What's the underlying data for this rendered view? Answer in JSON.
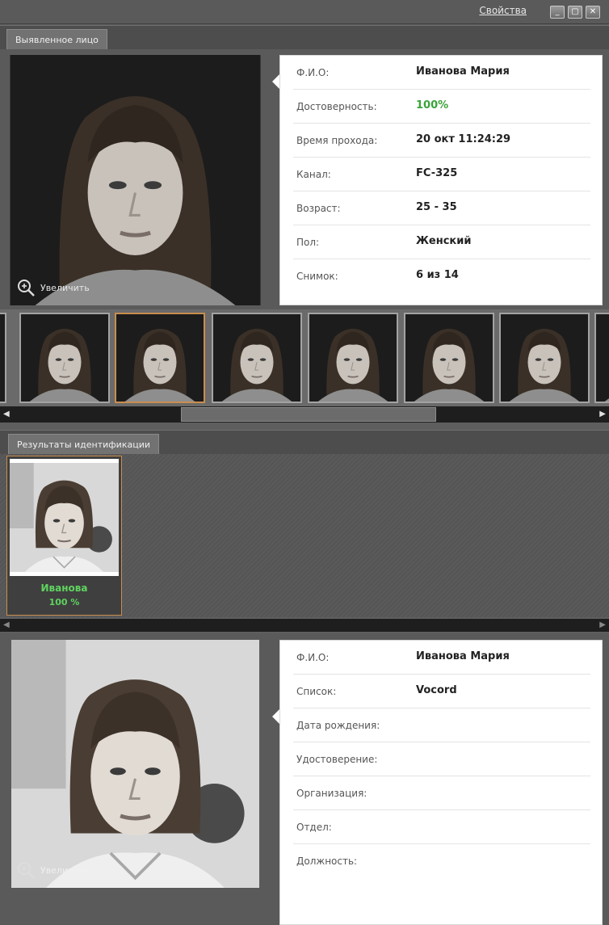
{
  "titlebar": {
    "properties_link": "Свойства",
    "min_glyph": "_",
    "max_glyph": "▢",
    "close_glyph": "✕"
  },
  "detected": {
    "tab_label": "Выявленное лицо",
    "zoom_label": "Увеличить",
    "fields": [
      {
        "label": "Ф.И.О:",
        "value": "Иванова Мария"
      },
      {
        "label": "Достоверность:",
        "value": "100%"
      },
      {
        "label": "Время прохода:",
        "value": "20 окт 11:24:29"
      },
      {
        "label": "Канал:",
        "value": "FC-325"
      },
      {
        "label": "Возраст:",
        "value": "25 - 35"
      },
      {
        "label": "Пол:",
        "value": "Женский"
      },
      {
        "label": "Снимок:",
        "value": "6 из 14"
      }
    ]
  },
  "filmstrip": {
    "selected_index": 1,
    "left_arrow": "◀",
    "right_arrow": "▶"
  },
  "results": {
    "tab_label": "Результаты идентификации",
    "match_name": "Иванова",
    "match_percent": "100 %",
    "left_arrow": "◀",
    "right_arrow": "▶"
  },
  "profile": {
    "zoom_label": "Увеличить",
    "fields": [
      {
        "label": "Ф.И.О:",
        "value": "Иванова Мария"
      },
      {
        "label": "Список:",
        "value": "Vocord"
      },
      {
        "label": "Дата рождения:",
        "value": ""
      },
      {
        "label": "Удостоверение:",
        "value": ""
      },
      {
        "label": "Организация:",
        "value": ""
      },
      {
        "label": "Отдел:",
        "value": ""
      },
      {
        "label": "Должность:",
        "value": ""
      }
    ]
  },
  "colors": {
    "accent_orange": "#c98e4e",
    "match_green": "#5fd35f",
    "confidence_green": "#3aa33a"
  }
}
